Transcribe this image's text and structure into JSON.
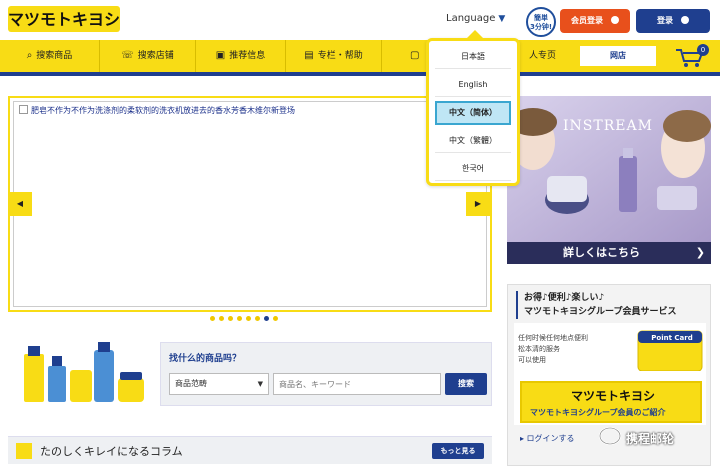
{
  "header": {
    "logo_text": "マツモトキヨシ",
    "language_label": "Language",
    "badge_line1": "簡単",
    "badge_line2": "3分钟!",
    "register_label": "会员登录",
    "login_label": "登录"
  },
  "nav": {
    "items": [
      {
        "label": "搜索商品",
        "icon": "search-icon"
      },
      {
        "label": "搜索店铺",
        "icon": "phone-icon"
      },
      {
        "label": "推荐信息",
        "icon": "gift-icon"
      },
      {
        "label": "专栏・帮助",
        "icon": "note-icon"
      },
      {
        "label": "",
        "icon": "bag-icon"
      },
      {
        "label": "人专页",
        "icon": "person-icon"
      }
    ],
    "shop_label": "网店",
    "cart_count": "0"
  },
  "carousel": {
    "caption": "肥皂不作为不作为洗涤剂的柔软剂的洗衣机放进去的香水芳香木维尔新登场",
    "prev_arrow": "◀",
    "next_arrow": "▶",
    "slide_count": 8,
    "active_index": 6
  },
  "ad": {
    "title": "INSTREAM",
    "cta": "詳しくはこちら",
    "cta_arrow": "❯"
  },
  "member": {
    "heading_line1": "お得♪便利♪楽しい♪",
    "heading_line2": "マツモトキヨシグループ会員サービス",
    "body_line1": "任何时候任何地点便利",
    "body_line2": "松本清的服务",
    "body_line3": "可以使用",
    "card_label": "Point Card",
    "cta_logo": "マツモトキヨシ",
    "cta_text": "マツモトキヨシグループ会員のご紹介",
    "login_link": "▸ ログインする"
  },
  "finder": {
    "title": "找什么的商品吗？",
    "select_value": "商品范畴",
    "input_placeholder": "商品名、キーワード",
    "button_label": "搜索"
  },
  "column": {
    "title": "たのしくキレイになるコラム",
    "more_label": "もっと見る"
  },
  "language_menu": {
    "options": [
      "日本語",
      "English",
      "中文（简体）",
      "中文（繁體）",
      "한국어"
    ],
    "selected": 2
  },
  "watermark": {
    "text": "携程邮轮"
  },
  "colors": {
    "brand_yellow": "#f8dc15",
    "brand_blue": "#1f3f8f",
    "register_orange": "#e8501c",
    "selected_bg": "#bfe6f5"
  }
}
